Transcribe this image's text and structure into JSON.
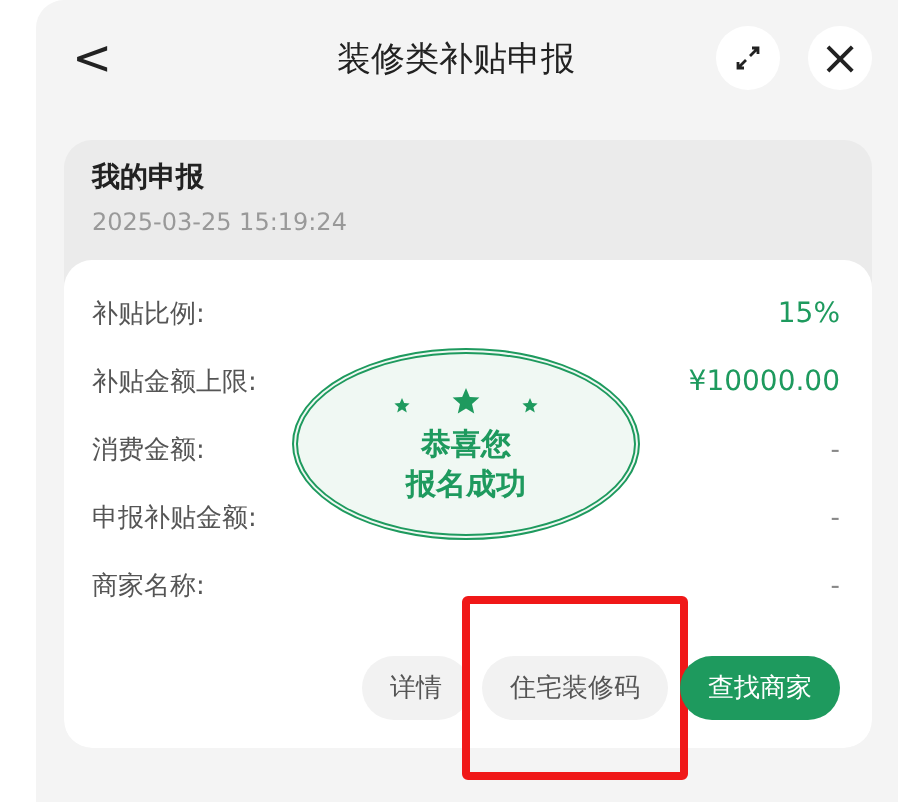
{
  "header": {
    "title": "装修类补贴申报",
    "back_icon": "<",
    "close_icon": "×"
  },
  "application": {
    "title": "我的申报",
    "time": "2025-03-25 15:19:24",
    "rows": [
      {
        "label": "补贴比例:",
        "value": "15%",
        "highlighted": true
      },
      {
        "label": "补贴金额上限:",
        "value": "¥10000.00",
        "highlighted": true
      },
      {
        "label": "消费金额:",
        "value": "-",
        "highlighted": false
      },
      {
        "label": "申报补贴金额:",
        "value": "-",
        "highlighted": false
      },
      {
        "label": "商家名称:",
        "value": "-",
        "highlighted": false
      }
    ],
    "stamp": {
      "lines": [
        "恭喜您",
        "报名成功"
      ]
    },
    "buttons": [
      {
        "label": "详情",
        "kind": "secondary",
        "annotated": false
      },
      {
        "label": "住宅装修码",
        "kind": "secondary",
        "annotated": true
      },
      {
        "label": "查找商家",
        "kind": "primary",
        "annotated": false
      }
    ]
  }
}
